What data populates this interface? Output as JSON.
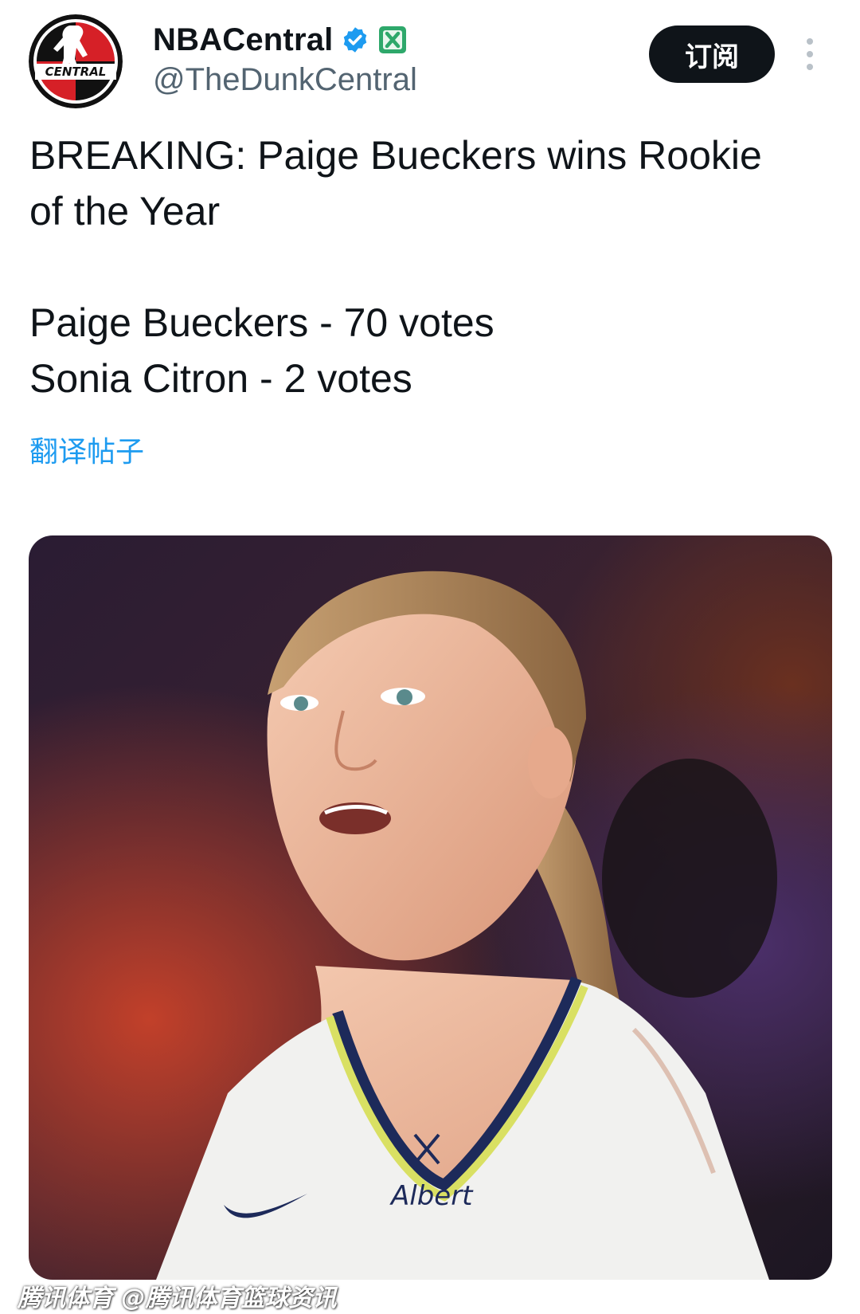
{
  "author": {
    "display_name": "NBACentral",
    "handle": "@TheDunkCentral",
    "avatar_text": "CENTRAL",
    "verified_icon": "verified-badge-icon",
    "affiliate_icon": "x-affiliate-badge-icon"
  },
  "actions": {
    "subscribe_label": "订阅",
    "more_icon": "more-vertical-icon"
  },
  "tweet": {
    "line1": "BREAKING: Paige Bueckers wins Rookie",
    "line2": "of the Year",
    "vote1": "Paige Bueckers - 70 votes",
    "vote2": "Sonia Citron - 2 votes",
    "translate_label": "翻译帖子"
  },
  "media": {
    "jersey_text": "Albert"
  },
  "watermark": "腾讯体育 @腾讯体育篮球资讯",
  "colors": {
    "link": "#1d9bf0",
    "verified": "#1d9bf0",
    "affiliate": "#2ea86b",
    "button_bg": "#0f1419"
  }
}
